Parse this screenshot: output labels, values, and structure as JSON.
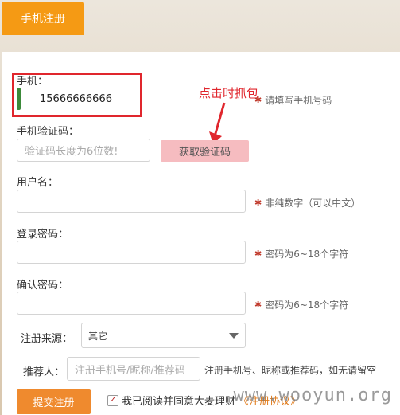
{
  "tab": {
    "label": "手机注册"
  },
  "phone": {
    "label": "手机：",
    "value": "15666666666",
    "hint": "请填写手机号码"
  },
  "annotation": {
    "text": "点击时抓包"
  },
  "sms": {
    "label": "手机验证码：",
    "placeholder": "验证码长度为6位数!",
    "button": "获取验证码"
  },
  "username": {
    "label": "用户名：",
    "hint": "非纯数字（可以中文）"
  },
  "password": {
    "label": "登录密码：",
    "hint": "密码为6~18个字符"
  },
  "confirm": {
    "label": "确认密码：",
    "hint": "密码为6~18个字符"
  },
  "source": {
    "label": "注册来源：",
    "selected": "其它"
  },
  "referrer": {
    "label": "推荐人：",
    "placeholder": "注册手机号/昵称/推荐码",
    "hint": "注册手机号、昵称或推荐码，如无请留空"
  },
  "submit": {
    "label": "提交注册"
  },
  "agree": {
    "text": "我已阅读并同意大麦理财",
    "link": "《注册协议》",
    "checkmark": "✓"
  },
  "watermark": {
    "text": "www.wooyun.org"
  },
  "colors": {
    "accent": "#f59a14",
    "alert": "#e0262d",
    "sms_button": "#f6bcc0"
  }
}
